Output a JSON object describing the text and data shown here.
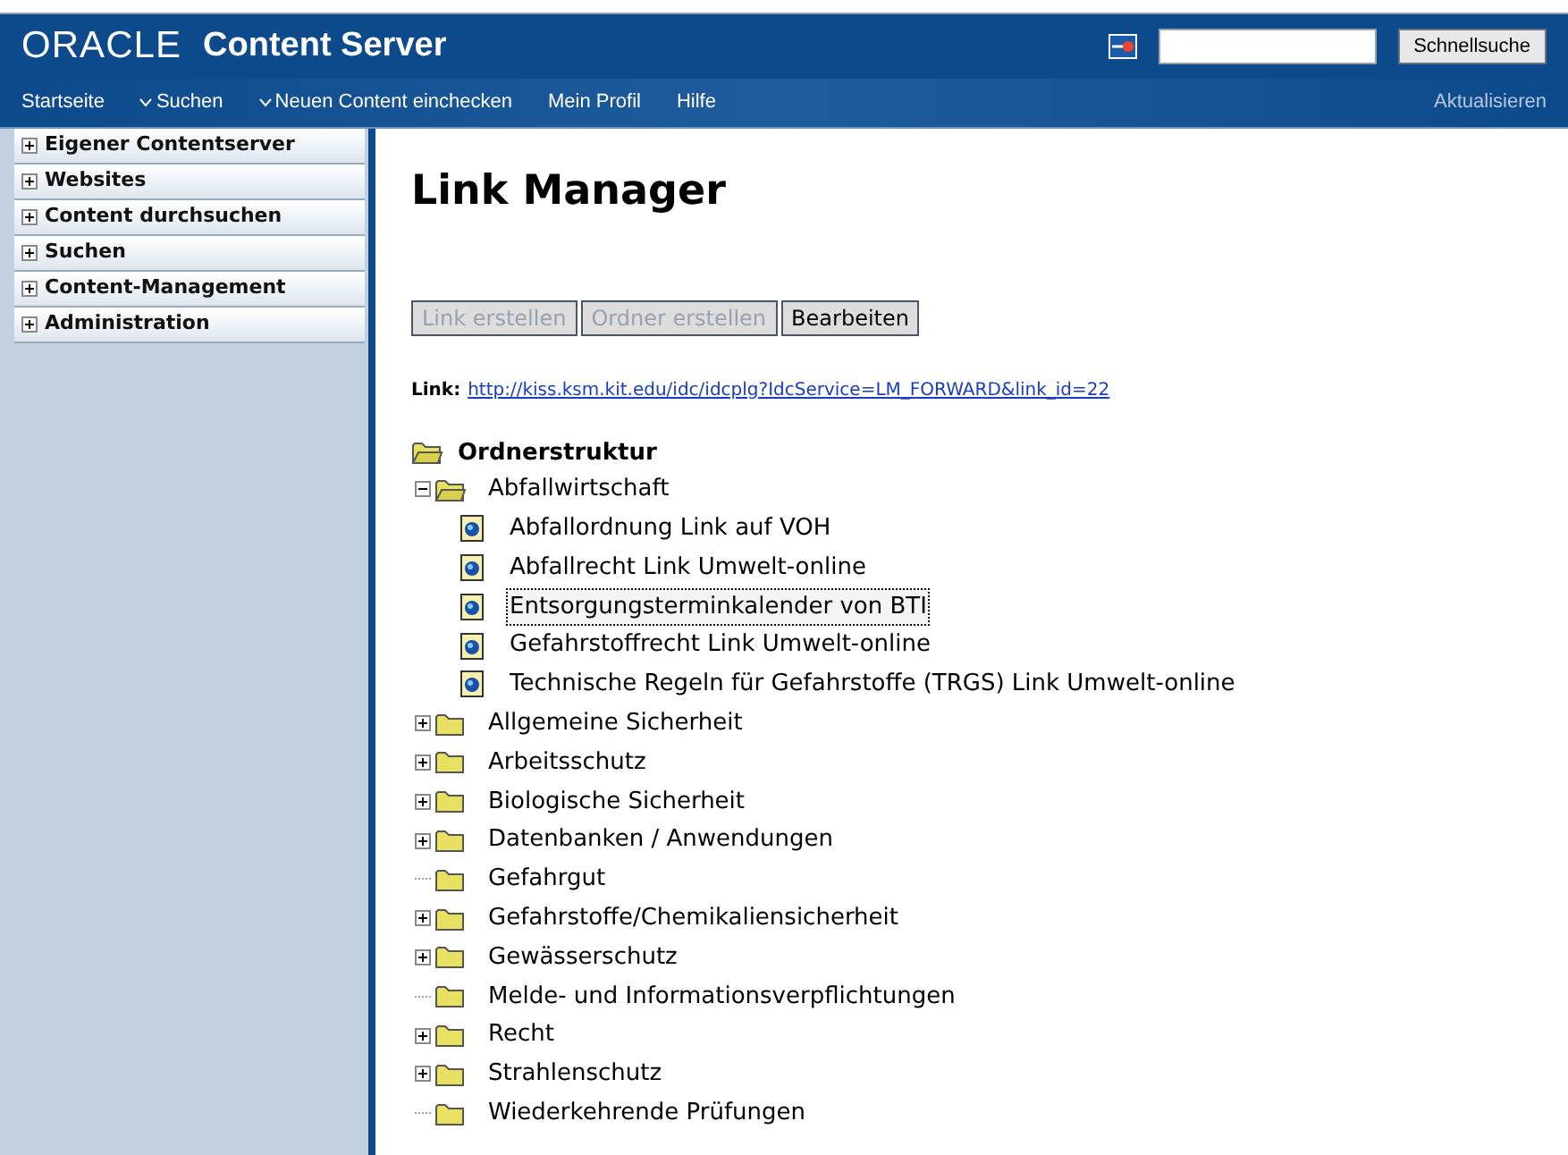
{
  "header": {
    "logo": "ORACLE",
    "product": "Content Server",
    "quick_search_button": "Schnellsuche"
  },
  "nav": {
    "items": [
      {
        "label": "Startseite",
        "dropdown": false
      },
      {
        "label": "Suchen",
        "dropdown": true
      },
      {
        "label": "Neuen Content einchecken",
        "dropdown": true
      },
      {
        "label": "Mein Profil",
        "dropdown": false
      },
      {
        "label": "Hilfe",
        "dropdown": false
      }
    ],
    "right": "Aktualisieren"
  },
  "sidebar": {
    "items": [
      {
        "label": "Eigener Contentserver",
        "expanded": false
      },
      {
        "label": "Websites",
        "expanded": false
      },
      {
        "label": "Content durchsuchen",
        "expanded": false
      },
      {
        "label": "Suchen",
        "expanded": false
      },
      {
        "label": "Content-Management",
        "expanded": false
      },
      {
        "label": "Administration",
        "expanded": false
      }
    ]
  },
  "page": {
    "title": "Link Manager",
    "buttons": [
      {
        "label": "Link erstellen",
        "disabled": true
      },
      {
        "label": "Ordner erstellen",
        "disabled": true
      },
      {
        "label": "Bearbeiten",
        "disabled": false
      }
    ],
    "link_label": "Link:",
    "link_url": "http://kiss.ksm.kit.edu/idc/idcplg?IdcService=LM_FORWARD&link_id=22"
  },
  "tree": {
    "root": "Ordnerstruktur",
    "children": [
      {
        "kind": "folder",
        "label": "Abfallwirtschaft",
        "expandable": true,
        "expanded": true,
        "selected": false,
        "children": [
          {
            "kind": "link",
            "label": "Abfallordnung Link auf VOH",
            "selected": false
          },
          {
            "kind": "link",
            "label": "Abfallrecht Link Umwelt-online",
            "selected": false
          },
          {
            "kind": "link",
            "label": "Entsorgungsterminkalender von BTI",
            "selected": true
          },
          {
            "kind": "link",
            "label": "Gefahrstoffrecht Link Umwelt-online",
            "selected": false
          },
          {
            "kind": "link",
            "label": "Technische Regeln für Gefahrstoffe (TRGS) Link Umwelt-online",
            "selected": false
          }
        ]
      },
      {
        "kind": "folder",
        "label": "Allgemeine Sicherheit",
        "expandable": true,
        "expanded": false,
        "selected": false
      },
      {
        "kind": "folder",
        "label": "Arbeitsschutz",
        "expandable": true,
        "expanded": false,
        "selected": false
      },
      {
        "kind": "folder",
        "label": "Biologische Sicherheit",
        "expandable": true,
        "expanded": false,
        "selected": false
      },
      {
        "kind": "folder",
        "label": "Datenbanken / Anwendungen",
        "expandable": true,
        "expanded": false,
        "selected": false
      },
      {
        "kind": "folder",
        "label": "Gefahrgut",
        "expandable": false,
        "expanded": false,
        "selected": false
      },
      {
        "kind": "folder",
        "label": "Gefahrstoffe/Chemikaliensicherheit",
        "expandable": true,
        "expanded": false,
        "selected": false
      },
      {
        "kind": "folder",
        "label": "Gewässerschutz",
        "expandable": true,
        "expanded": false,
        "selected": false
      },
      {
        "kind": "folder",
        "label": "Melde- und Informationsverpflichtungen",
        "expandable": false,
        "expanded": false,
        "selected": false
      },
      {
        "kind": "folder",
        "label": "Recht",
        "expandable": true,
        "expanded": false,
        "selected": false
      },
      {
        "kind": "folder",
        "label": "Strahlenschutz",
        "expandable": true,
        "expanded": false,
        "selected": false
      },
      {
        "kind": "folder",
        "label": "Wiederkehrende Prüfungen",
        "expandable": false,
        "expanded": false,
        "selected": false
      }
    ]
  }
}
